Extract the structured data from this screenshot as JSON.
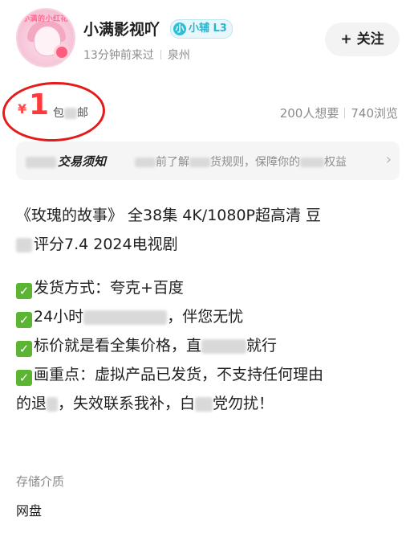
{
  "seller": {
    "avatar_text": "小满的小红花",
    "nickname": "小满影视吖",
    "badge_icon": "小",
    "badge_text": "小辅 L3",
    "last_seen": "13分钟前来过",
    "location": "泉州",
    "follow_label": "+ 关注"
  },
  "price": {
    "currency": "¥",
    "value": "1",
    "shipping_text": "包",
    "shipping_text_tail": "邮",
    "want_count": "200人想要",
    "view_count": "740浏览"
  },
  "notice": {
    "title": "交易须知",
    "text_a": "前了解",
    "text_b": "货规则，保障你的",
    "text_c": "权益",
    "arrow": "›"
  },
  "description": {
    "line1": "《玫瑰的故事》 全38集 4K/1080P超高清 豆",
    "line2": "评分7.4 2024电视剧",
    "bullet1_a": "发货方式：夸克+百度",
    "bullet2_a": "24小时",
    "bullet2_b": "，伴您无忧",
    "bullet3_a": "标价就是看全集价格，直",
    "bullet3_b": "就行",
    "bullet4_a": "画重点：虚拟产品已发货，不支持任何理由",
    "bullet4_b_a": "的退",
    "bullet4_b_b": "，失效联系我补，白",
    "bullet4_b_c": "党勿扰！",
    "check_mark": "✓"
  },
  "storage": {
    "label": "存储介质",
    "value": "网盘"
  },
  "colors": {
    "price_red": "#ff3a3a",
    "circle_red": "#e31b1b",
    "badge_cyan": "#27c0d8",
    "check_green": "#5bb533"
  }
}
